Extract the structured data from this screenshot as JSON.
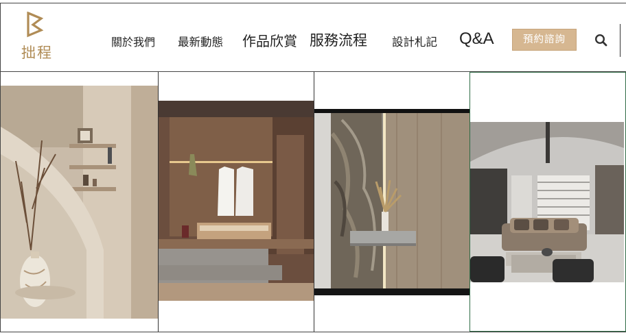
{
  "brand": {
    "name": "拙程",
    "logo_icon": "b-monogram-icon",
    "accent_color": "#b08c56"
  },
  "nav": {
    "items": [
      {
        "id": "about",
        "label": "關於我們"
      },
      {
        "id": "news",
        "label": "最新動態"
      },
      {
        "id": "works",
        "label": "作品欣賞"
      },
      {
        "id": "service",
        "label": "服務流程"
      },
      {
        "id": "notes",
        "label": "設計札記"
      },
      {
        "id": "qa",
        "label": "Q&A"
      }
    ],
    "cta_label": "預約諮詢",
    "cta_color": "#d6b791",
    "search_icon": "search-icon"
  },
  "gallery": {
    "tiles": [
      {
        "id": "staircase-shelf",
        "image": "staircase-with-wall-shelf-and-vase"
      },
      {
        "id": "walk-in-closet",
        "image": "walk-in-closet-with-hanging-shirts"
      },
      {
        "id": "marble-entry",
        "image": "marble-wall-with-floating-shelf"
      },
      {
        "id": "living-room",
        "image": "living-room-with-leather-sofas"
      }
    ]
  }
}
